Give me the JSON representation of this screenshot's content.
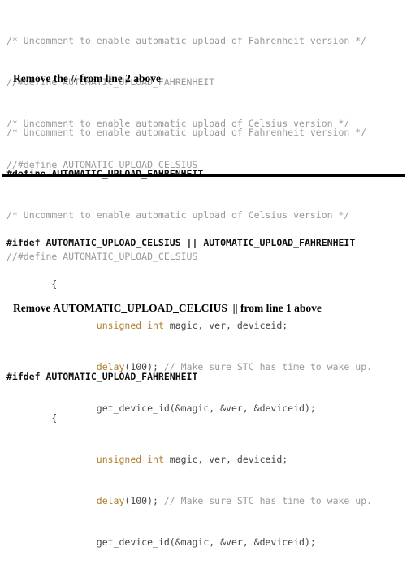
{
  "document": {
    "title": "Firmware #define / #ifdef edit instructions",
    "background_color": "#ffffff"
  },
  "colors": {
    "comment": "#9a9a9a",
    "directive": "#111111",
    "keyword": "#b07d2a",
    "plain_code": "#444444",
    "instruction_text": "#000000",
    "divider": "#000000"
  },
  "blocks": {
    "original": {
      "name": "original-defines",
      "lines": [
        "/* Uncomment to enable automatic upload of Fahrenheit version */",
        "//#define AUTOMATIC_UPLOAD_FAHRENHEIT",
        "/* Uncomment to enable automatic upload of Celsius version */",
        "//#define AUTOMATIC_UPLOAD_CELSIUS"
      ]
    },
    "edited": {
      "name": "edited-defines",
      "lines": [
        "/* Uncomment to enable automatic upload of Fahrenheit version */",
        "#define AUTOMATIC_UPLOAD_FAHRENHEIT",
        "/* Uncomment to enable automatic upload of Celsius version */",
        "//#define AUTOMATIC_UPLOAD_CELSIUS"
      ]
    },
    "ifdef_both": {
      "name": "ifdef-celsius-or-fahrenheit",
      "directive": "#ifdef AUTOMATIC_UPLOAD_CELSIUS || AUTOMATIC_UPLOAD_FAHRENHEIT",
      "brace": "{",
      "decl_keyword": "unsigned int",
      "decl_rest": " magic, ver, deviceid;",
      "delay_call": "delay",
      "delay_args": "(100); ",
      "delay_comment": "// Make sure STC has time to wake up.",
      "get_device_id": "get_device_id(&magic, &ver, &deviceid);"
    },
    "ifdef_fahrenheit": {
      "name": "ifdef-fahrenheit-only",
      "directive": "#ifdef AUTOMATIC_UPLOAD_FAHRENHEIT",
      "brace": "{",
      "decl_keyword": "unsigned int",
      "decl_rest": " magic, ver, deviceid;",
      "delay_call": "delay",
      "delay_args": "(100); ",
      "delay_comment": "// Make sure STC has time to wake up.",
      "get_device_id": "get_device_id(&magic, &ver, &deviceid);"
    }
  },
  "instructions": [
    {
      "name": "instruction-remove-slashes",
      "text": "Remove the // from line 2 above"
    },
    {
      "name": "instruction-remove-celcius",
      "text": "Remove AUTOMATIC_UPLOAD_CELCIUS  || from line 1 above"
    }
  ],
  "divider": {
    "name": "section-divider",
    "thickness_px": 4
  }
}
